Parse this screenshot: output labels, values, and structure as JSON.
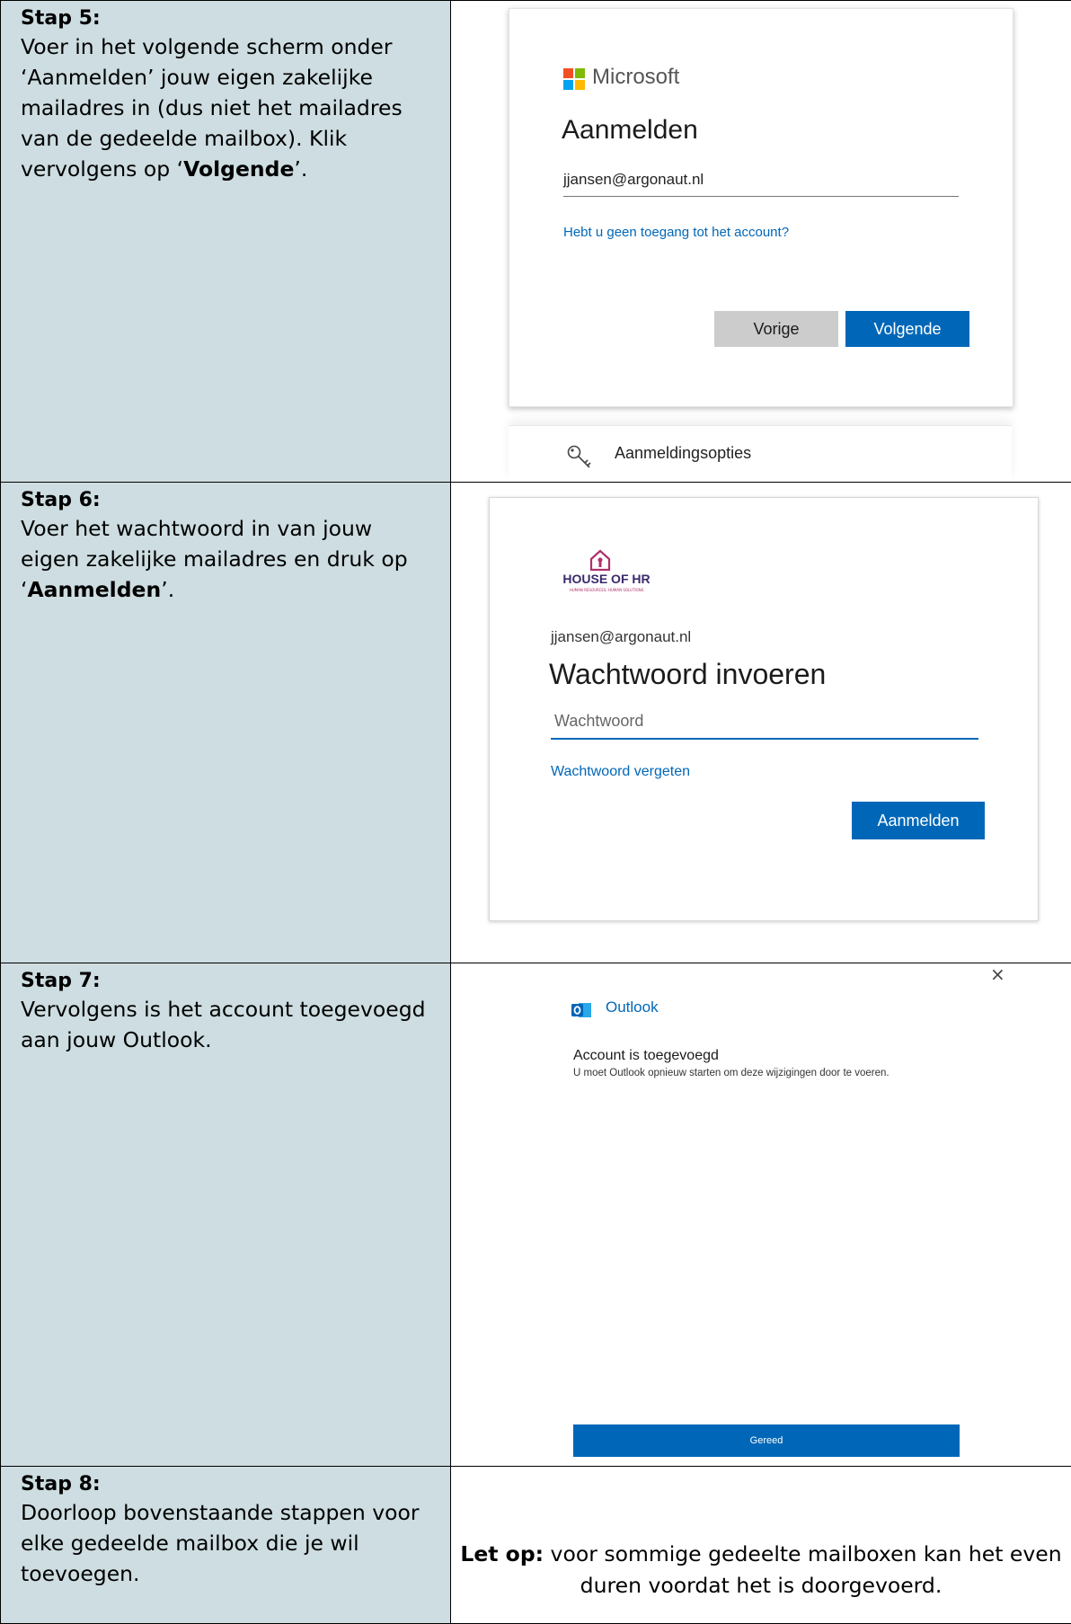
{
  "steps": [
    {
      "title": "Stap 5:",
      "text_before": "Voer in het volgende scherm onder ‘Aanmelden’ jouw eigen zakelijke mailadres in (dus niet het mailadres van de gedeelde mailbox). Klik vervolgens op ‘",
      "bold": "Volgende",
      "text_after": "’."
    },
    {
      "title": "Stap 6:",
      "text_before": "Voer het wachtwoord in van jouw eigen zakelijke mailadres en druk op ‘",
      "bold": "Aanmelden",
      "text_after": "’."
    },
    {
      "title": "Stap 7:",
      "text": "Vervolgens is het account toegevoegd aan jouw Outlook."
    },
    {
      "title": "Stap 8:",
      "text": "Doorloop bovenstaande stappen voor elke gedeelde mailbox die je wil toevoegen."
    }
  ],
  "signin": {
    "brand": "Microsoft",
    "heading": "Aanmelden",
    "email_value": "jjansen@argonaut.nl",
    "help_link": "Hebt u geen toegang tot het account?",
    "back_button": "Vorige",
    "next_button": "Volgende",
    "options_label": "Aanmeldingsopties",
    "logo_colors": [
      "#f25022",
      "#7fba00",
      "#00a4ef",
      "#ffb900"
    ]
  },
  "password": {
    "logo_text": "HOUSE OF HR",
    "logo_subtext": "HUMAN RESOURCES, HUMAN SOLUTIONS",
    "email": "jjansen@argonaut.nl",
    "heading": "Wachtwoord invoeren",
    "placeholder": "Wachtwoord",
    "forgot_link": "Wachtwoord vergeten",
    "signin_button": "Aanmelden"
  },
  "outlook": {
    "close_glyph": "×",
    "app_name": "Outlook",
    "heading": "Account is toegevoegd",
    "message": "U moet Outlook opnieuw starten om deze wijzigingen door te voeren.",
    "done_button": "Gereed"
  },
  "note": {
    "bold": "Let op:",
    "text": " voor sommige gedeelte mailboxen kan het even duren voordat het is doorgevoerd."
  }
}
